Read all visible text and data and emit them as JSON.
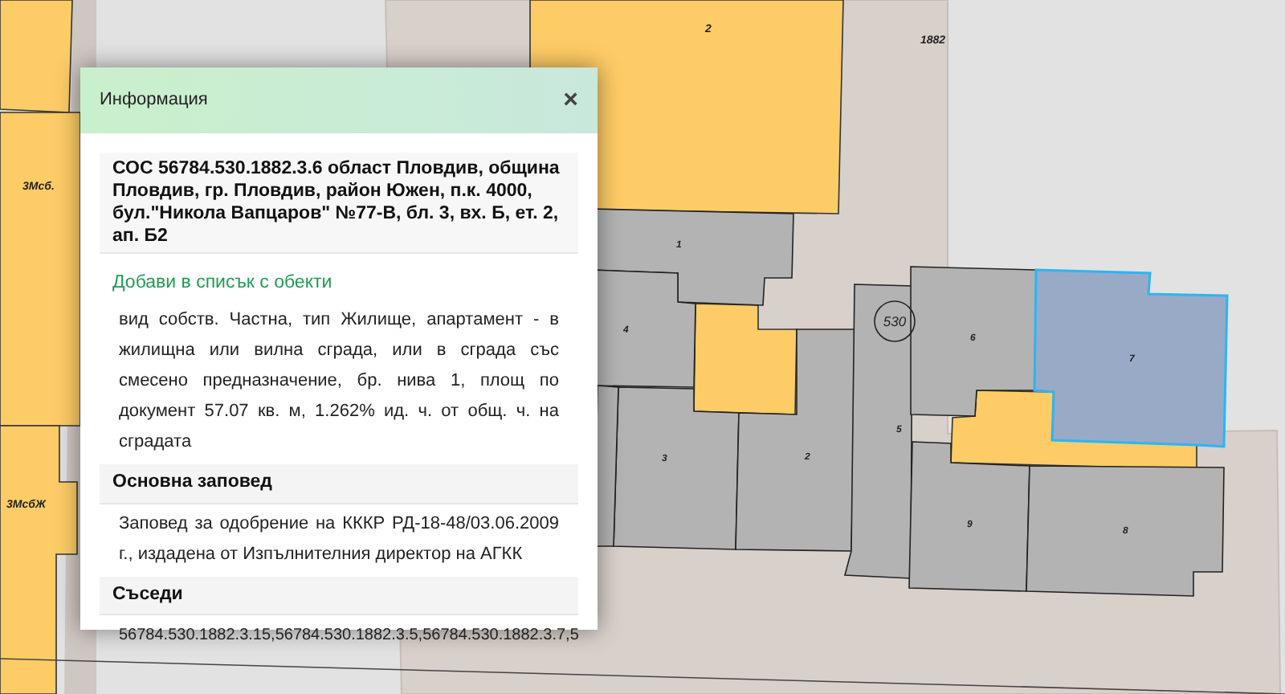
{
  "map": {
    "labels": [
      {
        "text": "2"
      },
      {
        "text": "1882"
      },
      {
        "text": "1"
      },
      {
        "text": "4"
      },
      {
        "text": "3"
      },
      {
        "text": "2"
      },
      {
        "text": "5"
      },
      {
        "text": "6"
      },
      {
        "text": "7"
      },
      {
        "text": "9"
      },
      {
        "text": "8"
      },
      {
        "text": "3Мсб."
      },
      {
        "text": "3МсбЖ"
      }
    ],
    "block_number": "530"
  },
  "dialog": {
    "title": "Информация",
    "close": "×",
    "heading": "СОС 56784.530.1882.3.6 област Пловдив, община Пловдив, гр. Пловдив, район Южен, п.к. 4000, бул.\"Никола Вапцаров\" №77-В, бл. 3, вх. Б, ет. 2, ап. Б2",
    "add_link": "Добави в списък с обекти",
    "description": "вид собств. Частна, тип Жилище, апартамент - в жилищна или вилна сграда, или в сграда със смесено предназначение, бр. нива 1, площ по документ 57.07 кв. м, 1.262% ид. ч. от общ. ч. на сградата",
    "sections": [
      {
        "title": "Основна заповед",
        "body": "Заповед за одобрение на КККР РД-18-48/03.06.2009 г., издадена от Изпълнителния директор на АГКК"
      },
      {
        "title": "Съседи",
        "body": "56784.530.1882.3.15,56784.530.1882.3.5,56784.530.1882.3.7,5"
      }
    ]
  }
}
